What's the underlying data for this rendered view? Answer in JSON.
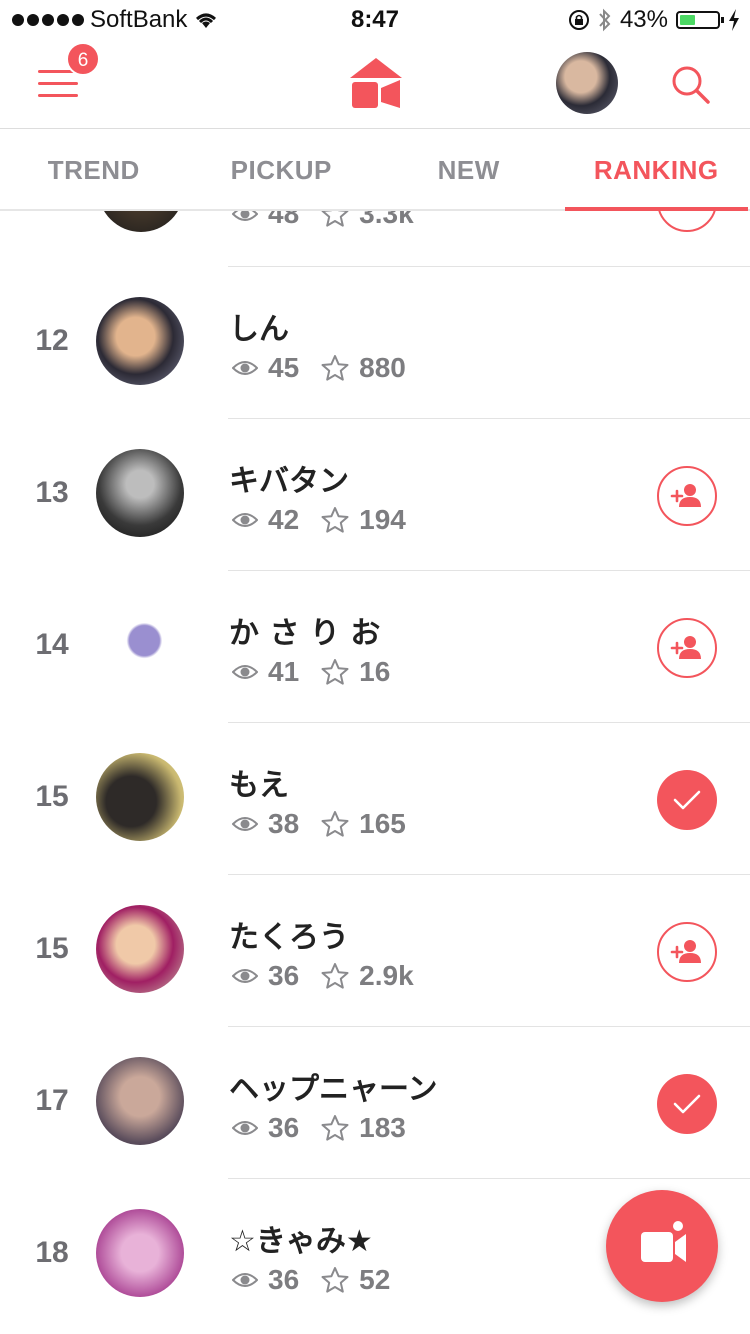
{
  "status_bar": {
    "carrier": "SoftBank",
    "time": "8:47",
    "battery": "43%",
    "battery_level": 0.43
  },
  "header": {
    "notification_count": "6"
  },
  "tabs": [
    {
      "label": "TREND",
      "active": false
    },
    {
      "label": "PICKUP",
      "active": false
    },
    {
      "label": "NEW",
      "active": false
    },
    {
      "label": "RANKING",
      "active": true
    }
  ],
  "partial_row": {
    "views": "48",
    "stars": "3.3k"
  },
  "rankings": [
    {
      "rank": "12",
      "name": "しん",
      "views": "45",
      "stars": "880",
      "follow": "none"
    },
    {
      "rank": "13",
      "name": "キバタン",
      "views": "42",
      "stars": "194",
      "follow": "add"
    },
    {
      "rank": "14",
      "name": "か さ り お",
      "views": "41",
      "stars": "16",
      "follow": "add"
    },
    {
      "rank": "15",
      "name": "もえ",
      "views": "38",
      "stars": "165",
      "follow": "following"
    },
    {
      "rank": "15",
      "name": "たくろう",
      "views": "36",
      "stars": "2.9k",
      "follow": "add"
    },
    {
      "rank": "17",
      "name": "ヘップニャーン",
      "views": "36",
      "stars": "183",
      "follow": "following"
    },
    {
      "rank": "18",
      "name": "☆きゃみ★",
      "views": "36",
      "stars": "52",
      "follow": "none"
    }
  ],
  "colors": {
    "accent": "#f3555c",
    "muted": "#8e8e93"
  }
}
